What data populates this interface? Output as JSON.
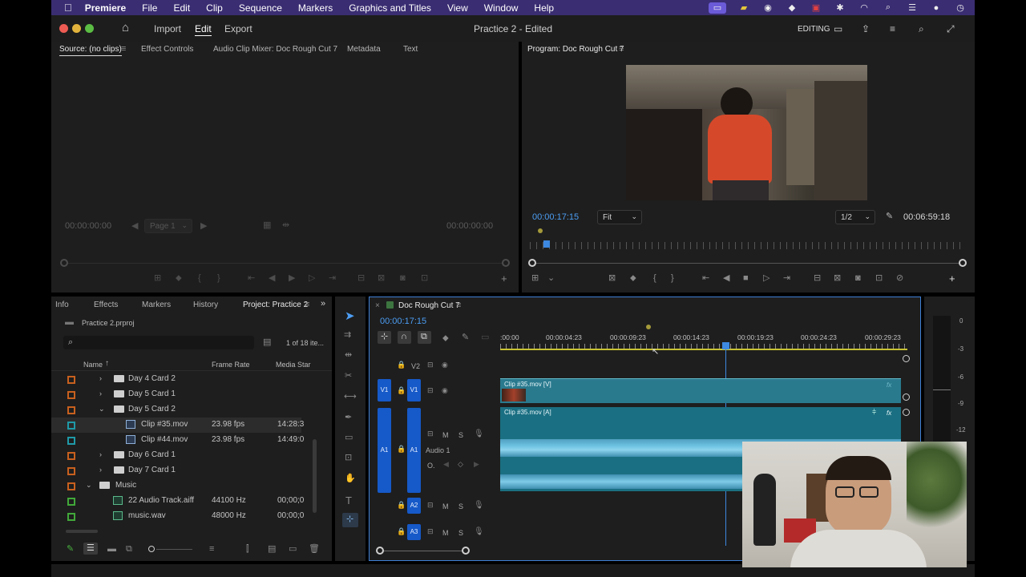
{
  "menubar": {
    "app": "Premiere",
    "items": [
      "File",
      "Edit",
      "Clip",
      "Sequence",
      "Markers",
      "Graphics and Titles",
      "View",
      "Window",
      "Help"
    ]
  },
  "titlebar": {
    "home": "Home",
    "nav": [
      "Import",
      "Edit",
      "Export"
    ],
    "doc_title": "Practice 2 - Edited",
    "workspace": "EDITING"
  },
  "source": {
    "tabs": [
      "Source: (no clips)",
      "Effect Controls",
      "Audio Clip Mixer: Doc Rough Cut 7",
      "Metadata",
      "Text"
    ],
    "tc_left": "00:00:00:00",
    "tc_right": "00:00:00:00",
    "page": "Page 1"
  },
  "program": {
    "tab": "Program: Doc Rough Cut 7",
    "tc_current": "00:00:17:15",
    "fit": "Fit",
    "resolution": "1/2",
    "tc_duration": "00:06:59:18"
  },
  "project": {
    "tabs": [
      "Info",
      "Effects",
      "Markers",
      "History",
      "Project: Practice 2"
    ],
    "file": "Practice 2.prproj",
    "count": "1 of 18 ite...",
    "search_placeholder": "",
    "columns": {
      "name": "Name",
      "frame_rate": "Frame Rate",
      "media_start": "Media Star"
    },
    "rows": [
      {
        "name": "Day 4 Card 2",
        "fr": "",
        "ms": ""
      },
      {
        "name": "Day 5 Card 1",
        "fr": "",
        "ms": ""
      },
      {
        "name": "Day 5 Card 2",
        "fr": "",
        "ms": ""
      },
      {
        "name": "Clip #35.mov",
        "fr": "23.98 fps",
        "ms": "14:28:3"
      },
      {
        "name": "Clip #44.mov",
        "fr": "23.98 fps",
        "ms": "14:49:0"
      },
      {
        "name": "Day 6 Card 1",
        "fr": "",
        "ms": ""
      },
      {
        "name": "Day 7 Card 1",
        "fr": "",
        "ms": ""
      },
      {
        "name": "Music",
        "fr": "",
        "ms": ""
      },
      {
        "name": "22 Audio Track.aiff",
        "fr": "44100 Hz",
        "ms": "00;00;0"
      },
      {
        "name": "music.wav",
        "fr": "48000 Hz",
        "ms": "00;00;0"
      }
    ],
    "colors": {
      "orange": "#c8601e",
      "teal": "#1f9aa8",
      "green": "#41a83a"
    }
  },
  "timeline": {
    "tab": "Doc Rough Cut 7",
    "tc": "00:00:17:15",
    "ruler": [
      ":00:00",
      "00:00:04:23",
      "00:00:09:23",
      "00:00:14:23",
      "00:00:19:23",
      "00:00:24:23",
      "00:00:29:23"
    ],
    "tracks": {
      "v2": "V2",
      "v1": "V1",
      "a1": "A1",
      "a1_name": "Audio 1",
      "a2": "A2",
      "a3": "A3",
      "m": "M",
      "s": "S",
      "o": "O."
    },
    "clip_video": "Clip #35.mov [V]",
    "clip_audio": "Clip #35.mov [A]",
    "fx": "fx"
  },
  "meter": {
    "labels": [
      "0",
      "-3",
      "-6",
      "-9",
      "-12"
    ]
  }
}
